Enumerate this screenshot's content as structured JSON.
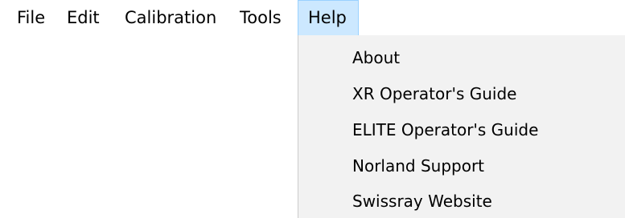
{
  "menubar": {
    "items": [
      {
        "label": "File"
      },
      {
        "label": "Edit"
      },
      {
        "label": "Calibration"
      },
      {
        "label": "Tools"
      },
      {
        "label": "Help"
      }
    ]
  },
  "help_menu": {
    "items": [
      {
        "label": "About"
      },
      {
        "label": "XR Operator's Guide"
      },
      {
        "label": "ELITE Operator's Guide"
      },
      {
        "label": "Norland Support"
      },
      {
        "label": "Swissray Website"
      }
    ]
  },
  "colors": {
    "menubar_background": "#ffffff",
    "help_highlight": "#cce8ff",
    "help_highlight_border": "#99d1ff",
    "dropdown_background": "#f2f2f2"
  }
}
